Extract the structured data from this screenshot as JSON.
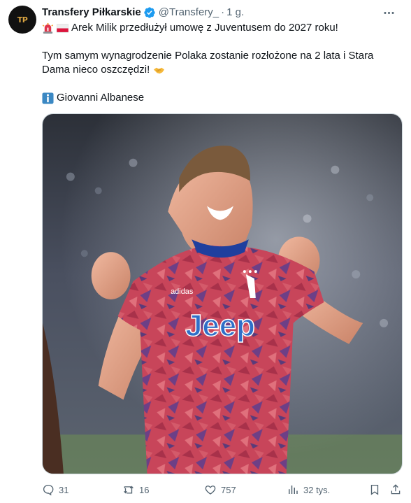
{
  "tweet": {
    "avatar_text": "TP",
    "display_name": "Transfery Piłkarskie",
    "handle": "@Transfery_",
    "separator": "·",
    "time": "1 g.",
    "lines": [
      "Arek Milik przedłużył umowę z Juventusem do 2027 roku!",
      "Tym samym wynagrodzenie Polaka zostanie rozłożone na 2 lata i Stara",
      "Dama nieco oszczędzi!",
      "Giovanni Albanese"
    ],
    "emojis": [
      "siren-emoji",
      "poland-flag-emoji",
      "handshake-emoji",
      "info-emoji"
    ],
    "image": {
      "kit_sponsor": "Jeep",
      "kit_brand": "adidas"
    }
  },
  "actions": {
    "replies": "31",
    "retweets": "16",
    "likes": "757",
    "views": "32 tys."
  },
  "colors": {
    "verified": "#1d9bf0",
    "text": "#0f1419",
    "secondary": "#536471",
    "shirt": "#c8455a",
    "shirt_trim": "#1f3f9e"
  }
}
